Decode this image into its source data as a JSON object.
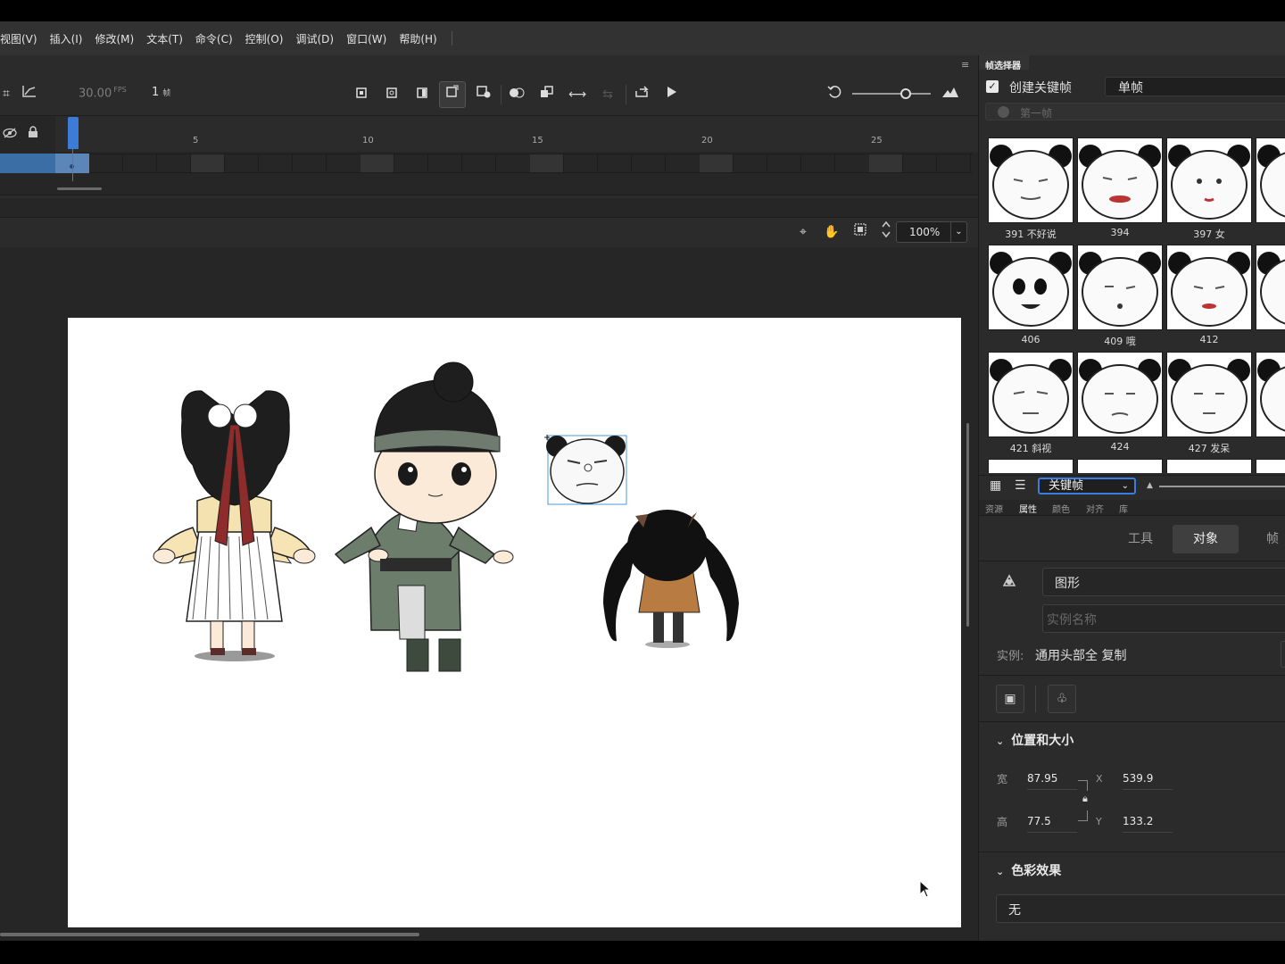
{
  "menu": {
    "items": [
      "视图(V)",
      "插入(I)",
      "修改(M)",
      "文本(T)",
      "命令(C)",
      "控制(O)",
      "调试(D)",
      "窗口(W)",
      "帮助(H)"
    ]
  },
  "timeline": {
    "fps": "30.00",
    "fps_unit": "FPS",
    "frame": "1",
    "frame_unit": "帧",
    "ruler_ticks": [
      "5",
      "10",
      "15",
      "20",
      "25"
    ]
  },
  "stage": {
    "zoom": "100%"
  },
  "frame_picker": {
    "title": "帧选择器",
    "create_keyframe_label": "创建关键帧",
    "create_keyframe_checked": true,
    "mode_value": "单帧",
    "first_frame_label": "第一帧",
    "thumbnails": [
      {
        "label": "391 不好说"
      },
      {
        "label": "394"
      },
      {
        "label": "397 女"
      },
      {
        "label": "406"
      },
      {
        "label": "409 哦"
      },
      {
        "label": "412"
      },
      {
        "label": "421 斜视"
      },
      {
        "label": "424"
      },
      {
        "label": "427 发呆"
      }
    ],
    "filter_value": "关键帧"
  },
  "properties": {
    "panel_tabs": [
      "资源",
      "属性",
      "颜色",
      "对齐",
      "库"
    ],
    "active_panel_tab": "属性",
    "segment_tabs": [
      "工具",
      "对象",
      "帧"
    ],
    "active_segment": "对象",
    "symbol_type": "图形",
    "instance_name_placeholder": "实例名称",
    "instance_label": "实例:",
    "instance_value": "通用头部全 复制",
    "position_size": {
      "title": "位置和大小",
      "width_label": "宽",
      "width_value": "87.95",
      "height_label": "高",
      "height_value": "77.5",
      "x_label": "X",
      "x_value": "539.9",
      "y_label": "Y",
      "y_value": "133.2"
    },
    "color_effect": {
      "title": "色彩效果",
      "value": "无"
    }
  },
  "colors": {
    "accent": "#3c7bd6",
    "panel_bg": "#2b2b2b",
    "stage_bg": "#ffffff"
  }
}
